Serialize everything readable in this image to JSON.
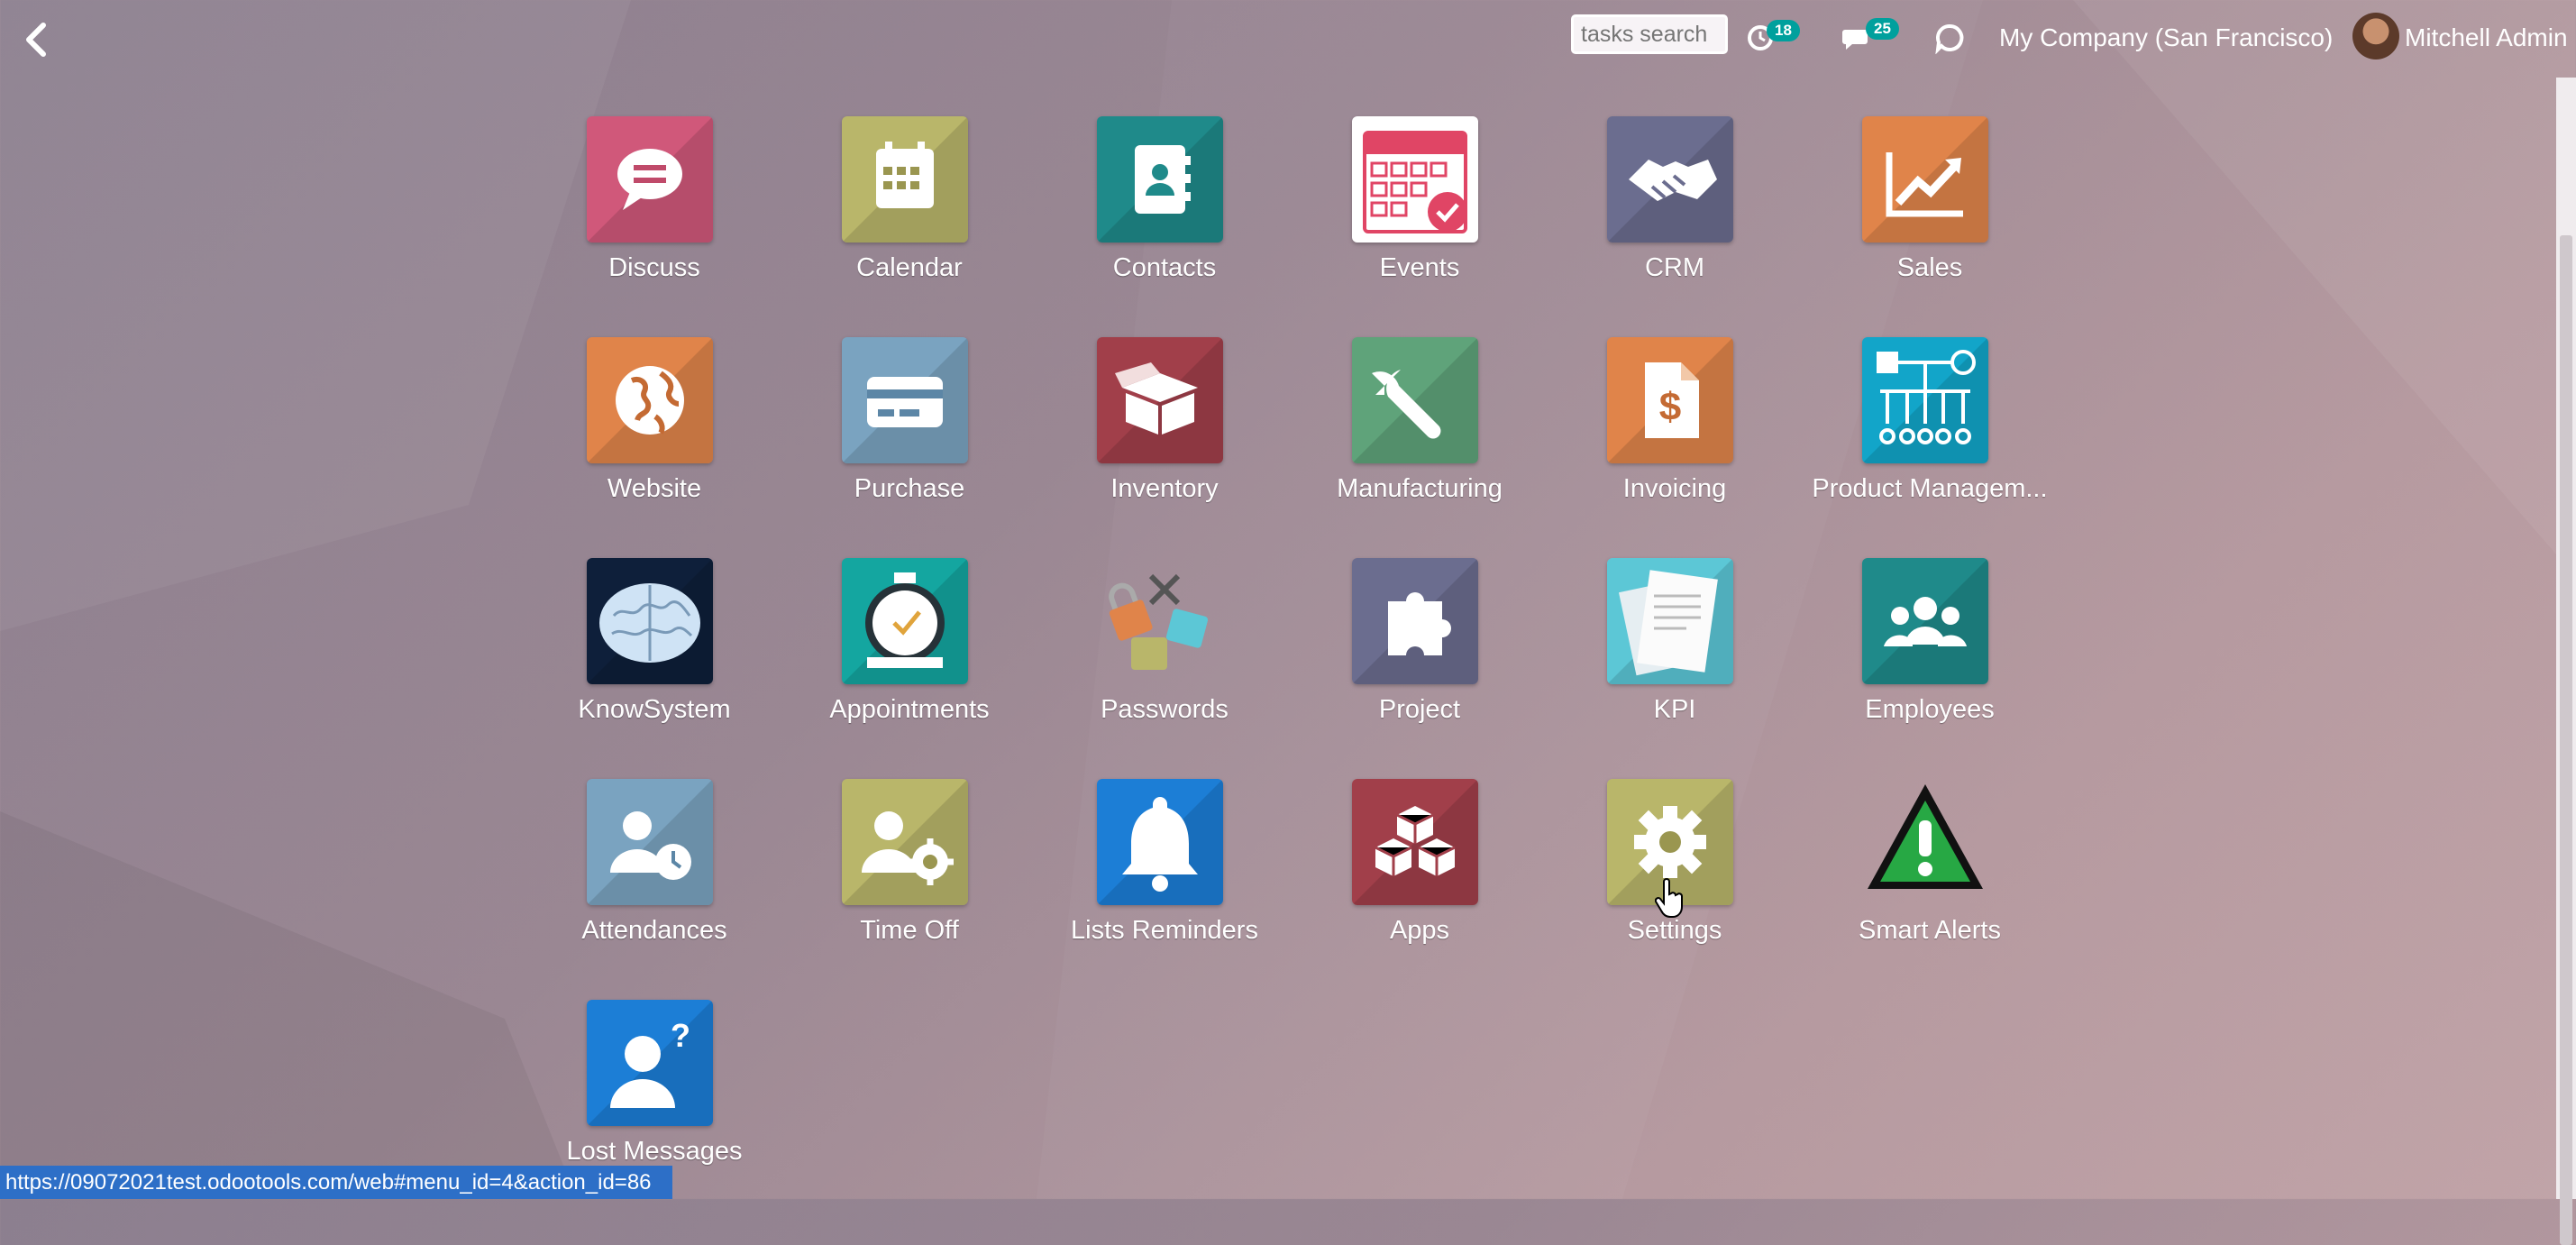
{
  "topbar": {
    "back_label": "Back",
    "search_placeholder": "tasks search",
    "activity_count": "18",
    "messages_count": "25",
    "company": "My Company (San Francisco)",
    "user": "Mitchell Admin"
  },
  "apps": [
    {
      "label": "Discuss",
      "icon": "chat-icon",
      "color": "#d0587a"
    },
    {
      "label": "Calendar",
      "icon": "calendar-icon",
      "color": "#b9b66a"
    },
    {
      "label": "Contacts",
      "icon": "address-book-icon",
      "color": "#1f8a8a"
    },
    {
      "label": "Events",
      "icon": "event-calendar-icon",
      "color": "#ffffff"
    },
    {
      "label": "CRM",
      "icon": "handshake-icon",
      "color": "#6b6d8f"
    },
    {
      "label": "Sales",
      "icon": "trend-chart-icon",
      "color": "#e0844a"
    },
    {
      "label": "Website",
      "icon": "globe-icon",
      "color": "#e0844a"
    },
    {
      "label": "Purchase",
      "icon": "credit-card-icon",
      "color": "#7aa3c0"
    },
    {
      "label": "Inventory",
      "icon": "box-icon",
      "color": "#a13f4a"
    },
    {
      "label": "Manufacturing",
      "icon": "wrench-icon",
      "color": "#5fa37a"
    },
    {
      "label": "Invoicing",
      "icon": "invoice-icon",
      "color": "#e0844a"
    },
    {
      "label": "Product Managem...",
      "icon": "diagram-icon",
      "color": "#12a5c9"
    },
    {
      "label": "KnowSystem",
      "icon": "brain-icon",
      "color": "#0e1f3a"
    },
    {
      "label": "Appointments",
      "icon": "clock-icon",
      "color": "#14a6a0"
    },
    {
      "label": "Passwords",
      "icon": "locks-icon",
      "color": "transparent"
    },
    {
      "label": "Project",
      "icon": "puzzle-icon",
      "color": "#6b6d8f"
    },
    {
      "label": "KPI",
      "icon": "documents-icon",
      "color": "#5cc7d6"
    },
    {
      "label": "Employees",
      "icon": "people-icon",
      "color": "#1f8a8a"
    },
    {
      "label": "Attendances",
      "icon": "user-clock-icon",
      "color": "#7aa3c0"
    },
    {
      "label": "Time Off",
      "icon": "user-gear-icon",
      "color": "#b9b66a"
    },
    {
      "label": "Lists Reminders",
      "icon": "bell-icon",
      "color": "#1c7ed6"
    },
    {
      "label": "Apps",
      "icon": "cubes-icon",
      "color": "#a13f4a"
    },
    {
      "label": "Settings",
      "icon": "gear-icon",
      "color": "#b9b66a"
    },
    {
      "label": "Smart Alerts",
      "icon": "alert-triangle-icon",
      "color": "transparent"
    },
    {
      "label": "Lost Messages",
      "icon": "user-question-icon",
      "color": "#1c7ed6"
    }
  ],
  "status_bar": {
    "url": "https://09072021test.odootools.com/web#menu_id=4&action_id=86"
  }
}
